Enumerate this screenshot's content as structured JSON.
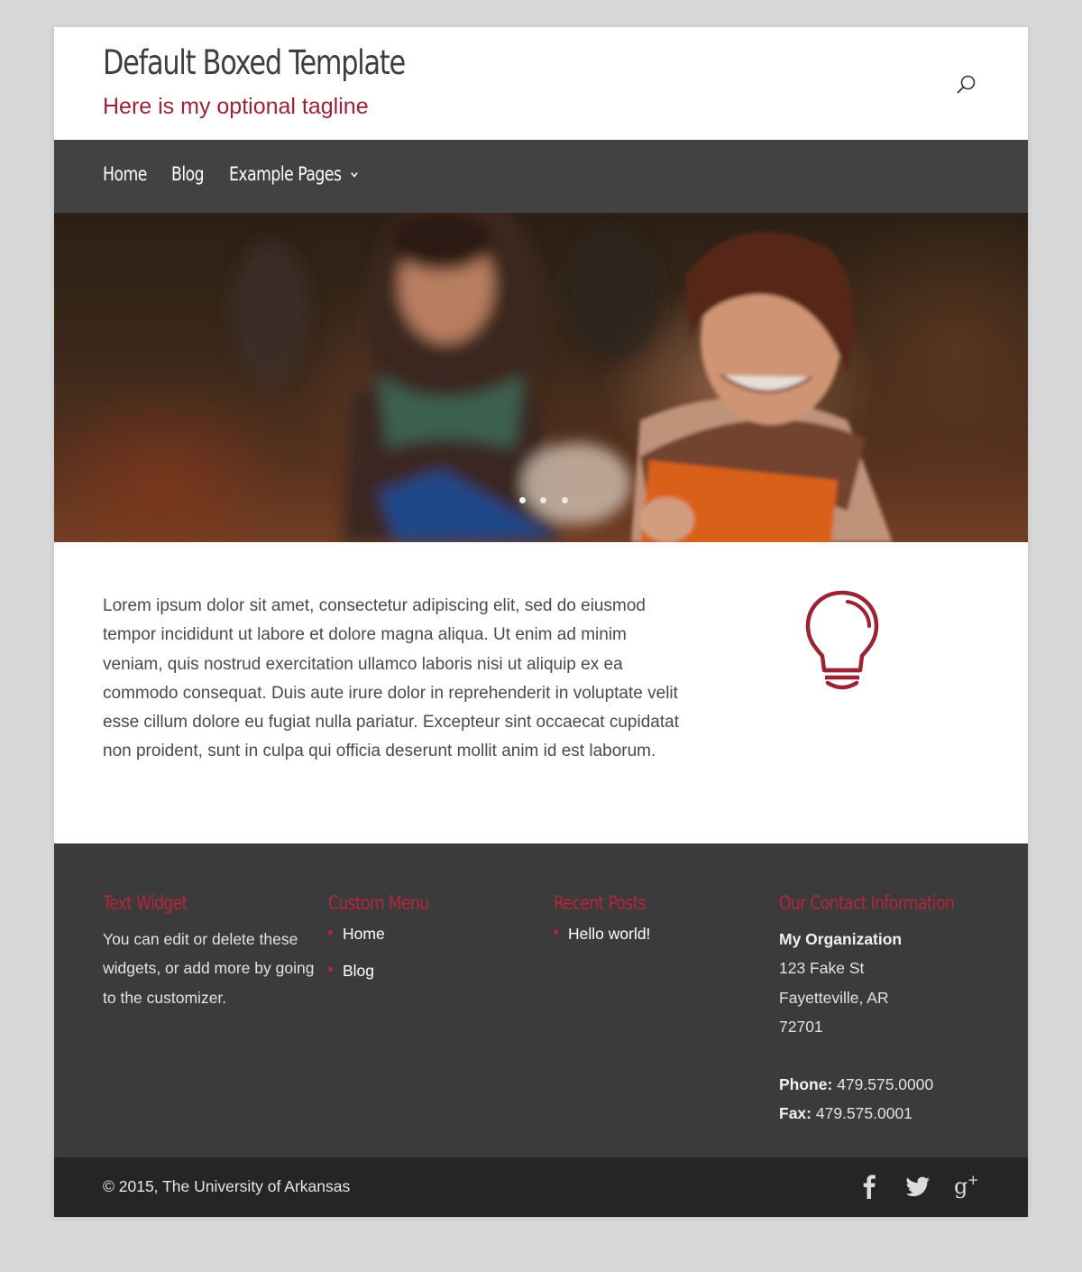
{
  "header": {
    "site_title": "Default Boxed Template",
    "tagline": "Here is my optional tagline"
  },
  "icons": {
    "search": "search-icon",
    "bulb": "lightbulb-icon",
    "facebook": "facebook-icon",
    "twitter": "twitter-icon",
    "googleplus": "google-plus-icon"
  },
  "nav": {
    "items": [
      {
        "label": "Home"
      },
      {
        "label": "Blog"
      },
      {
        "label": "Example Pages"
      }
    ]
  },
  "hero": {
    "slide_count": 3,
    "active_slide": 1
  },
  "content": {
    "body": "Lorem ipsum dolor sit amet, consectetur adipiscing elit, sed do eiusmod tempor incididunt ut labore et dolore magna aliqua. Ut enim ad minim veniam, quis nostrud exercitation ullamco laboris nisi ut aliquip ex ea commodo consequat. Duis aute irure dolor in reprehenderit in voluptate velit esse cillum dolore eu fugiat nulla pariatur. Excepteur sint occaecat cupidatat non proident, sunt in culpa qui officia deserunt mollit anim id est laborum."
  },
  "footer": {
    "text_widget": {
      "heading": "Text Widget",
      "text": "You can edit or delete these widgets, or add more by going to the customizer."
    },
    "custom_menu": {
      "heading": "Custom Menu",
      "items": [
        "Home",
        "Blog"
      ]
    },
    "recent_posts": {
      "heading": "Recent Posts",
      "items": [
        "Hello world!"
      ]
    },
    "contact": {
      "heading": "Our Contact Information",
      "org": "My Organization",
      "street": "123 Fake St",
      "city": "Fayetteville, AR",
      "zip": "72701",
      "phone_label": "Phone:",
      "phone": "479.575.0000",
      "fax_label": "Fax:",
      "fax": "479.575.0001"
    }
  },
  "bottom": {
    "copyright": "© 2015, The University of Arkansas"
  },
  "colors": {
    "accent": "#9d2235",
    "nav_bg": "#424242",
    "footer_bg": "#3b3b3b",
    "bottom_bg": "#252525",
    "page_bg": "#d8d8d8"
  }
}
